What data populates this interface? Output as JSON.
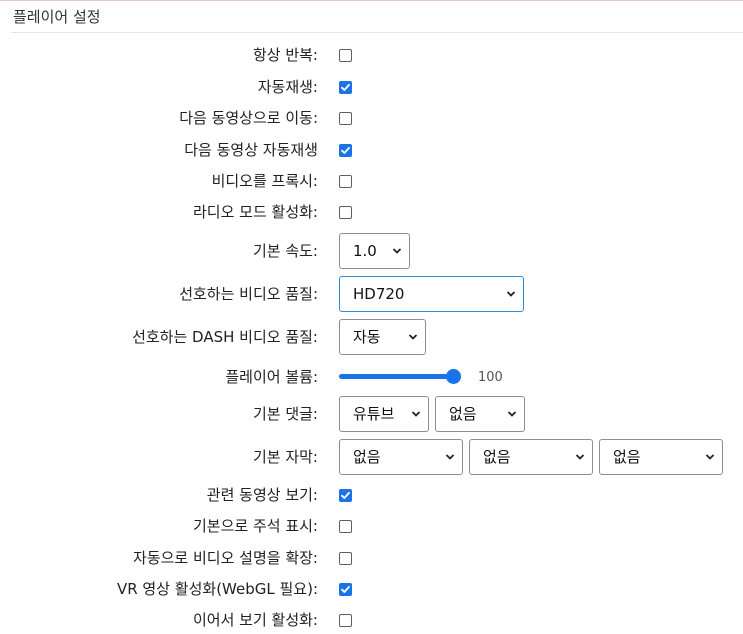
{
  "section": {
    "title": "플레이어 설정"
  },
  "settings": {
    "always_loop": {
      "label": "항상 반복:",
      "checked": false
    },
    "autoplay": {
      "label": "자동재생:",
      "checked": true
    },
    "continue_next": {
      "label": "다음 동영상으로 이동:",
      "checked": false
    },
    "autoplay_next": {
      "label": "다음 동영상 자동재생",
      "checked": true
    },
    "proxy_videos": {
      "label": "비디오를 프록시:",
      "checked": false
    },
    "audio_mode": {
      "label": "라디오 모드 활성화:",
      "checked": false
    },
    "speed": {
      "label": "기본 속도:",
      "value": "1.0"
    },
    "quality": {
      "label": "선호하는 비디오 품질:",
      "value": "HD720"
    },
    "dash_quality": {
      "label": "선호하는 DASH 비디오 품질:",
      "value": "자동"
    },
    "volume": {
      "label": "플레이어 볼륨:",
      "value": 100,
      "value_text": "100"
    },
    "comments": {
      "label": "기본 댓글:",
      "primary": "유튜브",
      "secondary": "없음"
    },
    "captions": {
      "label": "기본 자막:",
      "first": "없음",
      "second": "없음",
      "third": "없음"
    },
    "related_videos": {
      "label": "관련 동영상 보기:",
      "checked": true
    },
    "annotations": {
      "label": "기본으로 주석 표시:",
      "checked": false
    },
    "extend_desc": {
      "label": "자동으로 비디오 설명을 확장:",
      "checked": false
    },
    "vr_mode": {
      "label": "VR 영상 활성화(WebGL 필요):",
      "checked": true
    },
    "save_position": {
      "label": "이어서 보기 활성화:",
      "checked": false
    }
  },
  "colors": {
    "accent": "#1a73e8",
    "focus_border": "#2e8fd6"
  },
  "icons": {
    "select_arrow": "chevron-down-icon",
    "check": "checkmark-icon"
  }
}
